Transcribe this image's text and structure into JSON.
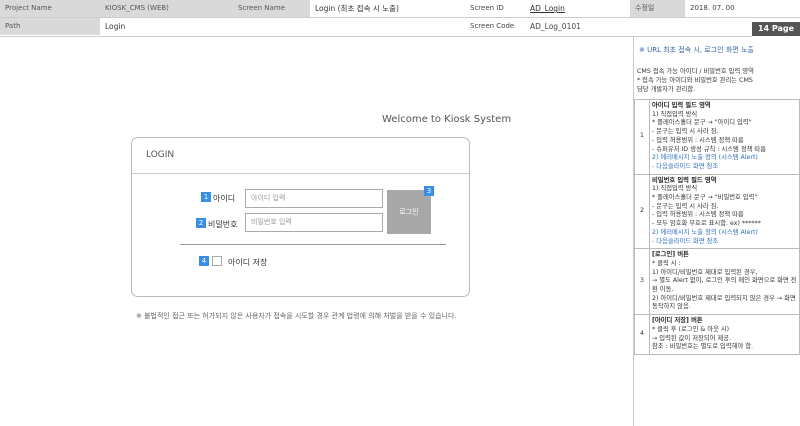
{
  "header": {
    "project_name_label": "Project Name",
    "project_name_value": "KIOSK_CMS (WEB)",
    "screen_name_label": "Screen Name",
    "screen_name_value": "Login (최초 접속 시 노출)",
    "screen_id_label": "Screen ID",
    "screen_id_value": "AD_Login",
    "revised_label": "수정일",
    "revised_value": "2018. 07. 00",
    "path_label": "Path",
    "path_value": "Login",
    "screen_code_label": "Screen Code",
    "screen_code_value": "AD_Log_0101",
    "page_badge": "14 Page"
  },
  "main": {
    "welcome": "Welcome to Kiosk System",
    "login_title": "LOGIN",
    "id_label": "아이디",
    "id_placeholder": "아이디 입력",
    "pw_label": "비밀번호",
    "pw_placeholder": "비밀번호 입력",
    "login_button": "로그인",
    "save_id_label": "아이디 저장",
    "notice": "※ 불법적인 접근 또는 허가되지 않은 사용자가 접속을 시도할 경우 관계 법령에 의해 처벌을 받을 수 있습니다.",
    "markers": [
      "1",
      "2",
      "3",
      "4"
    ]
  },
  "side": {
    "url_note": "※ URL 최초 접속 시, 로그인 화면 노출",
    "intro": [
      "CMS 접속 가능 아이디 / 비밀번호 입력 영역",
      "* 접속 가능 아이디와 비밀번호 관리는 CMS",
      "담당 개발자가 관리함."
    ],
    "rows": [
      {
        "num": "1",
        "title": "아이디 입력 필드 영역",
        "lines": [
          "1) 직접입력 방식",
          "* 플레이스홀더 문구 → \"아이디 입력\"",
          "- 문구는 입력 시 사라 짐.",
          "- 입력 허용범위 : 시스템 정책 따름",
          "- 슈퍼유저 ID 생성 규칙 : 시스템 정책 따름"
        ],
        "blue_lines": [
          "2) 에러메시지 노출 정의 (시스템 Alert)",
          "- 다음슬라이드 화면 참조"
        ]
      },
      {
        "num": "2",
        "title": "비밀번호 입력 필드 영역",
        "lines": [
          "1) 직접입력 방식",
          "* 플레이스홀더 문구 → \"비밀번호 입력\"",
          "- 문구는 입력 시 사라 짐.",
          "- 입력 허용범위 : 시스템 정책 따름",
          "- 모두 암호화 부호로 표시함. ex) ******"
        ],
        "blue_lines": [
          "2) 에러메시지 노출 정의 (시스템 Alert)",
          "- 다음슬라이드 화면 참조"
        ]
      },
      {
        "num": "3",
        "title": "[로그인] 버튼",
        "lines": [
          "* 클릭 시 :",
          "1) 아이디/비밀번호 제대로 입력된 경우,",
          "→ 별도 Alert 없이, 로그인 후의 메인 화면으로 화면 전환 이동.",
          "2) 아이디/비밀번호 제대로 입력되지 않은 경우 → 화면 동작하지 않음."
        ],
        "blue_lines": []
      },
      {
        "num": "4",
        "title": "[아이디 저장] 버튼",
        "lines": [
          "* 클릭 후 (로그인 & 아웃 시)",
          "→ 입력된 값이 저장되어 제공.",
          "참조 : 비밀번호는 별도로 입력해야 함."
        ],
        "blue_lines": []
      }
    ]
  }
}
